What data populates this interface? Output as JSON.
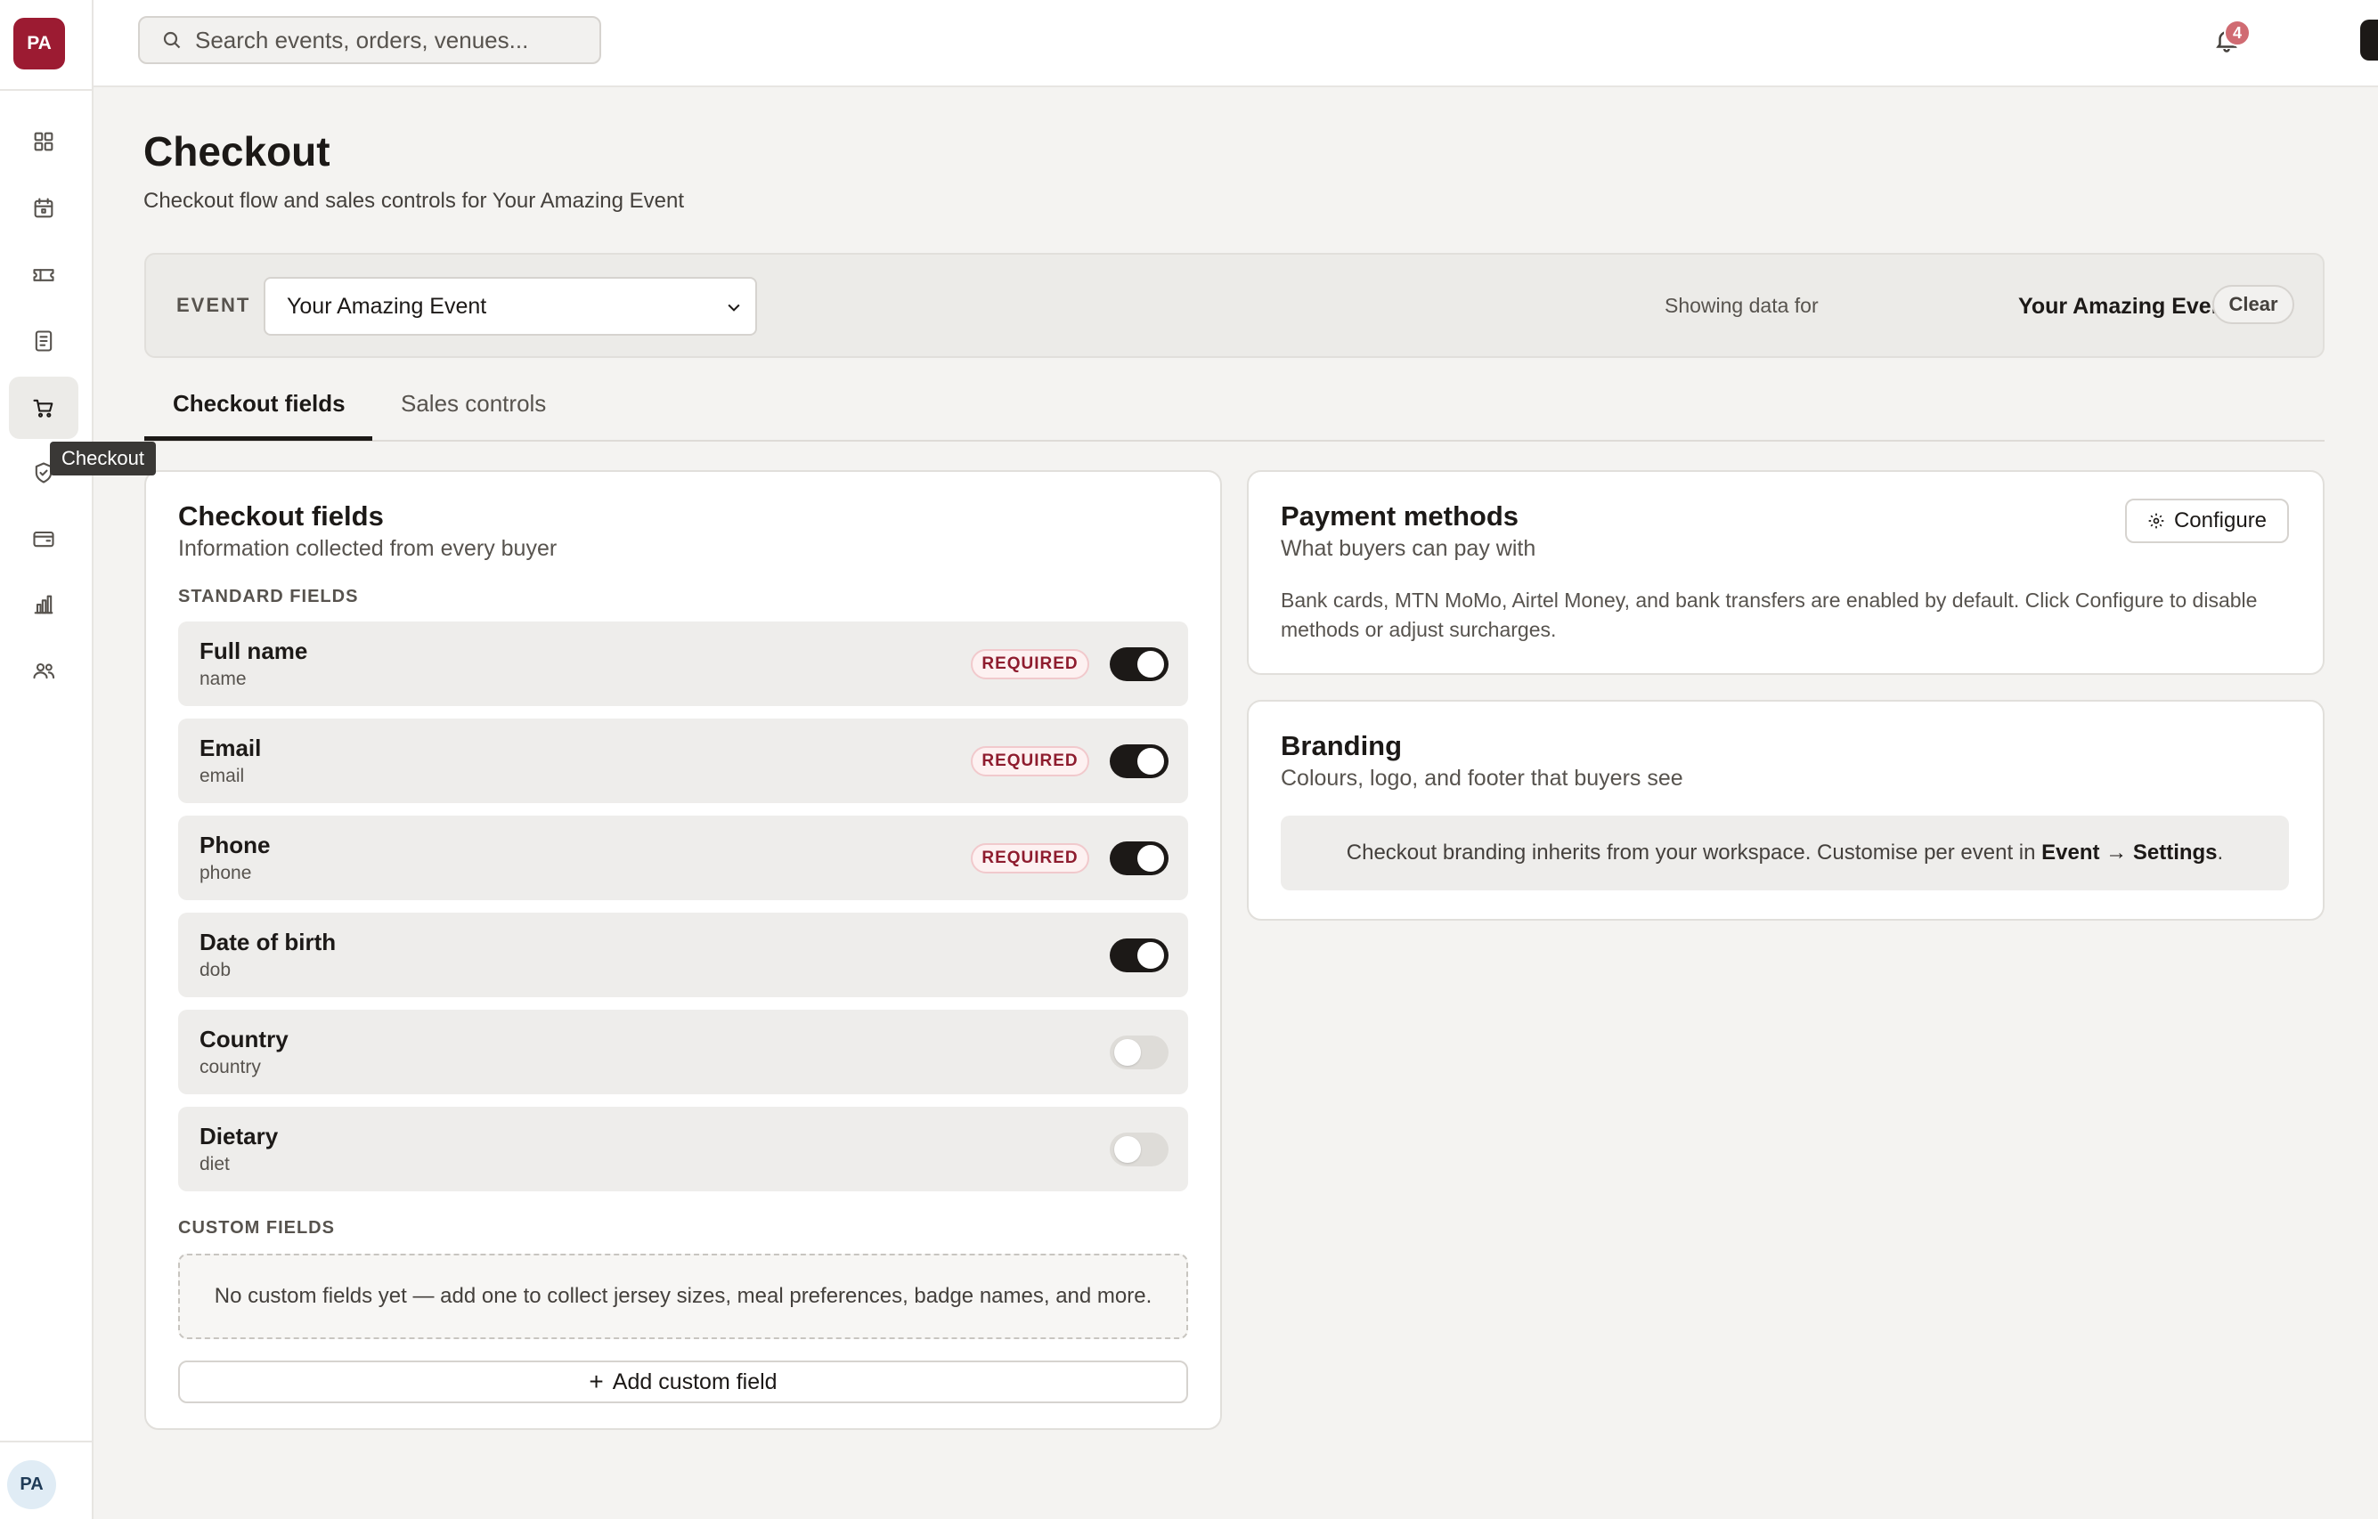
{
  "app": {
    "logo_text": "PA",
    "avatar_initials": "PA"
  },
  "sidebar": {
    "tooltip": "Checkout",
    "items": [
      {
        "icon": "dashboard-icon"
      },
      {
        "icon": "calendar-icon"
      },
      {
        "icon": "ticket-icon"
      },
      {
        "icon": "document-icon"
      },
      {
        "icon": "cart-icon",
        "active": true
      },
      {
        "icon": "shield-check-icon"
      },
      {
        "icon": "wallet-icon"
      },
      {
        "icon": "bar-chart-icon"
      },
      {
        "icon": "users-icon"
      }
    ]
  },
  "topbar": {
    "search_placeholder": "Search events, orders, venues...",
    "notification_count": "4"
  },
  "page": {
    "title": "Checkout",
    "subtitle": "Checkout flow and sales controls for Your Amazing Event"
  },
  "event_bar": {
    "label": "EVENT",
    "selected_event": "Your Amazing Event",
    "showing_label": "Showing data for",
    "showing_event": "Your Amazing Event",
    "clear_label": "Clear"
  },
  "tabs": [
    {
      "label": "Checkout fields",
      "active": true
    },
    {
      "label": "Sales controls",
      "active": false
    }
  ],
  "checkout_fields": {
    "title": "Checkout fields",
    "subtitle": "Information collected from every buyer",
    "standard_label": "STANDARD FIELDS",
    "required_label": "REQUIRED",
    "fields": [
      {
        "name": "Full name",
        "key": "name",
        "required": true,
        "enabled": true
      },
      {
        "name": "Email",
        "key": "email",
        "required": true,
        "enabled": true
      },
      {
        "name": "Phone",
        "key": "phone",
        "required": true,
        "enabled": true
      },
      {
        "name": "Date of birth",
        "key": "dob",
        "required": false,
        "enabled": true
      },
      {
        "name": "Country",
        "key": "country",
        "required": false,
        "enabled": false
      },
      {
        "name": "Dietary",
        "key": "diet",
        "required": false,
        "enabled": false
      }
    ],
    "custom_label": "CUSTOM FIELDS",
    "custom_empty": "No custom fields yet — add one to collect jersey sizes, meal preferences, badge names, and more.",
    "add_custom_label": "Add custom field"
  },
  "payment_methods": {
    "title": "Payment methods",
    "subtitle": "What buyers can pay with",
    "configure_label": "Configure",
    "description": "Bank cards, MTN MoMo, Airtel Money, and bank transfers are enabled by default. Click Configure to disable methods or adjust surcharges."
  },
  "branding": {
    "title": "Branding",
    "subtitle": "Colours, logo, and footer that buyers see",
    "note_prefix": "Checkout branding inherits from your workspace. Customise per event in ",
    "note_link": "Event → Settings",
    "note_suffix": "."
  }
}
